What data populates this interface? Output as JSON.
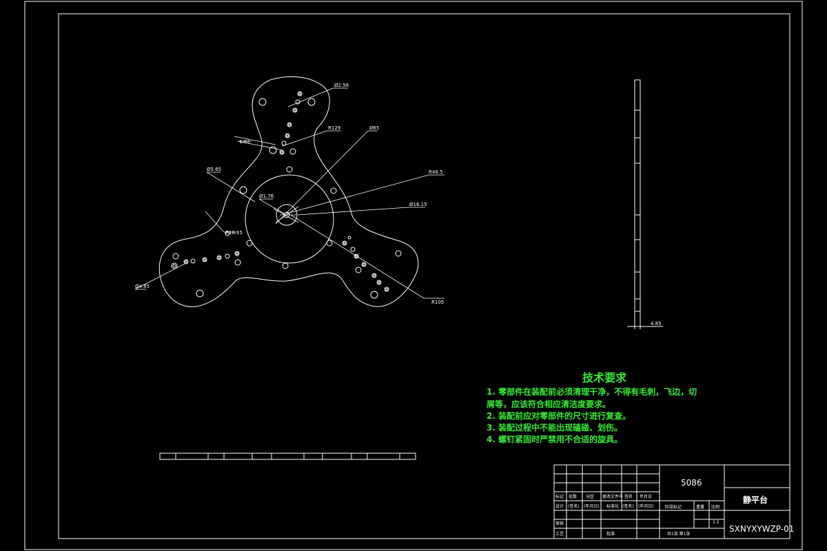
{
  "drawing": {
    "dimensions": {
      "d258": "Ø2.58",
      "d162": "1.62",
      "r129": "R129",
      "d65": "Ø65",
      "d565": "Ø5.65",
      "r485": "R48.5",
      "d176": "Ø1.76",
      "d1615": "Ø16.15",
      "r1615": "R16.15",
      "d485": "Ø4.85",
      "r105": "R105",
      "thk": "4.85"
    },
    "requirements": {
      "title": "技术要求",
      "line1": "1. 零部件在装配前必须清理干净，不得有毛刺，飞边，切",
      "line1b": "屑等，应该符合相应清洁度要求。",
      "line2": "2. 装配前应对零部件的尺寸进行复查。",
      "line3": "3. 装配过程中不能出现磕碰、划伤。",
      "line4": "4. 螺钉紧固时严禁用不合适的旋具。"
    },
    "title_block": {
      "material": "5086",
      "part_name": "静平台",
      "drawing_no": "SXNYXYWZP-01",
      "h_mark": "标记",
      "h_count": "处数",
      "h_zone": "分区",
      "h_docno": "更改文件号",
      "h_sign": "签名",
      "h_date": "年月日",
      "r_design": "设计",
      "r_sign1": "(签名)",
      "r_date1": "(年月日)",
      "r_std": "标准化",
      "r_sign2": "(签名)",
      "r_date2": "(年月日)",
      "stage": "阶段标记",
      "weight": "重量",
      "scale": "比例",
      "scale_val": "1:1",
      "review": "审核",
      "process": "工艺",
      "approve": "批准",
      "sheets": "共1张  第1张"
    }
  }
}
